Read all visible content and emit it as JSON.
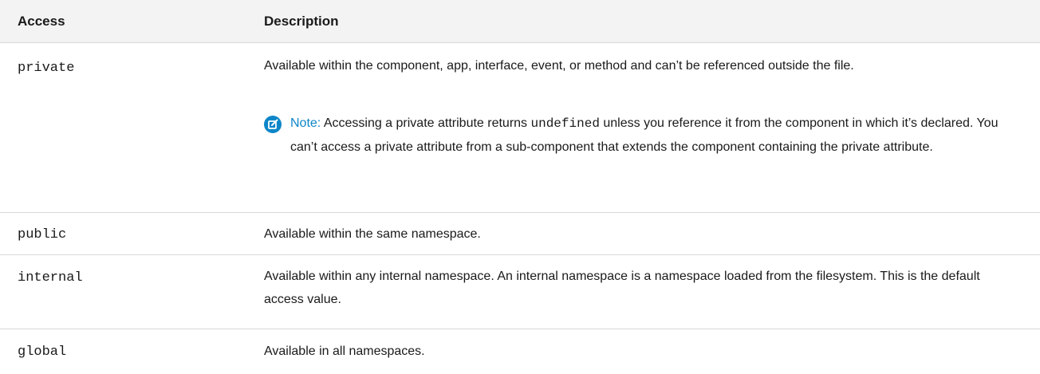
{
  "table": {
    "headers": {
      "access": "Access",
      "description": "Description"
    },
    "rows": [
      {
        "access": "private",
        "description": "Available within the component, app, interface, event, or method and can’t be referenced outside the file.",
        "note": {
          "label": "Note:",
          "text_before": "Accessing a private attribute returns",
          "code": "undefined",
          "text_after": "unless you reference it from the component in which it’s declared. You can’t access a private attribute from a sub-component that extends the component containing the private attribute."
        }
      },
      {
        "access": "public",
        "description": "Available within the same namespace."
      },
      {
        "access": "internal",
        "description": "Available within any internal namespace. An internal namespace is a namespace loaded from the filesystem. This is the default access value."
      },
      {
        "access": "global",
        "description": "Available in all namespaces."
      }
    ]
  },
  "icons": {
    "note": "note-edit-icon"
  },
  "colors": {
    "note_accent": "#0d86c8",
    "header_background": "#f3f3f3",
    "row_divider": "#d8d8d8"
  }
}
